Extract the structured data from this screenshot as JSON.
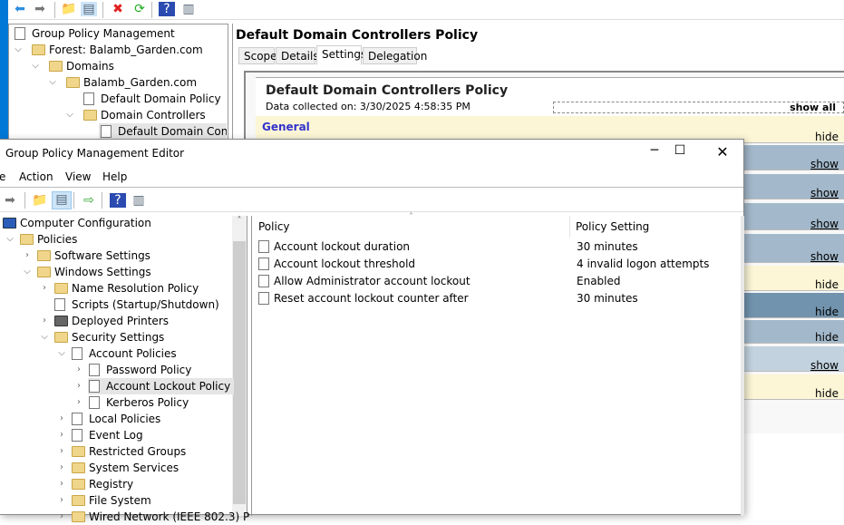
{
  "back": {
    "tree": [
      "Group Policy Management",
      "Forest: Balamb_Garden.com",
      "Domains",
      "Balamb_Garden.com",
      "Default Domain Policy",
      "Domain Controllers",
      "Default Domain Contro"
    ],
    "title": "Default Domain Controllers Policy",
    "tabs": [
      "Scope",
      "Details",
      "Settings",
      "Delegation"
    ],
    "active_tab": "Settings",
    "report_title": "Default Domain Controllers Policy",
    "collected": "Data collected on: 3/30/2025 4:58:35 PM",
    "show_all": "show all",
    "general": "General",
    "toggles": [
      "hide",
      "show",
      "show",
      "show",
      "show",
      "hide",
      "hide",
      "hide",
      "show",
      "hide"
    ]
  },
  "editor": {
    "title": "Group Policy Management Editor",
    "menu": [
      "e",
      "Action",
      "View",
      "Help"
    ],
    "tree": [
      {
        "label": "Computer Configuration",
        "level": 0,
        "chev": ""
      },
      {
        "label": "Policies",
        "level": 1,
        "chev": "down"
      },
      {
        "label": "Software Settings",
        "level": 2,
        "chev": "right"
      },
      {
        "label": "Windows Settings",
        "level": 2,
        "chev": "down"
      },
      {
        "label": "Name Resolution Policy",
        "level": 3,
        "chev": "right"
      },
      {
        "label": "Scripts (Startup/Shutdown)",
        "level": 3,
        "chev": ""
      },
      {
        "label": "Deployed Printers",
        "level": 3,
        "chev": "right"
      },
      {
        "label": "Security Settings",
        "level": 3,
        "chev": "down"
      },
      {
        "label": "Account Policies",
        "level": 4,
        "chev": "down"
      },
      {
        "label": "Password Policy",
        "level": 5,
        "chev": "right"
      },
      {
        "label": "Account Lockout Policy",
        "level": 5,
        "chev": "right",
        "selected": true
      },
      {
        "label": "Kerberos Policy",
        "level": 5,
        "chev": "right"
      },
      {
        "label": "Local Policies",
        "level": 4,
        "chev": "right"
      },
      {
        "label": "Event Log",
        "level": 4,
        "chev": "right"
      },
      {
        "label": "Restricted Groups",
        "level": 4,
        "chev": "right"
      },
      {
        "label": "System Services",
        "level": 4,
        "chev": "right"
      },
      {
        "label": "Registry",
        "level": 4,
        "chev": "right"
      },
      {
        "label": "File System",
        "level": 4,
        "chev": "right"
      },
      {
        "label": "Wired Network (IEEE 802.3) P",
        "level": 4,
        "chev": "right"
      }
    ],
    "columns": [
      "Policy",
      "Policy Setting"
    ],
    "rows": [
      {
        "policy": "Account lockout duration",
        "setting": "30 minutes"
      },
      {
        "policy": "Account lockout threshold",
        "setting": "4 invalid logon attempts"
      },
      {
        "policy": "Allow Administrator account lockout",
        "setting": "Enabled"
      },
      {
        "policy": "Reset account lockout counter after",
        "setting": "30 minutes"
      }
    ]
  },
  "colors": {
    "desktop": "#0078d7",
    "yellow": "#fcf6d7",
    "blue": "#a3b9cb",
    "dark_blue": "#7193ad",
    "light_blue": "#c2d3df"
  }
}
